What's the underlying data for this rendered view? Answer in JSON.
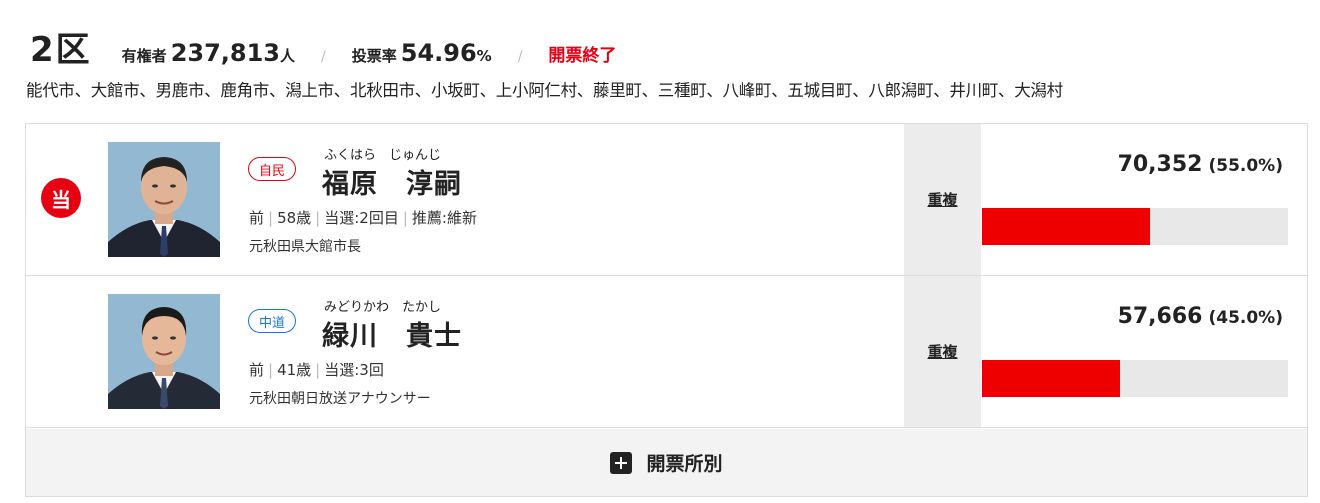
{
  "district": {
    "name": "2区",
    "electorate_label": "有権者",
    "electorate_value": "237,813",
    "electorate_unit": "人",
    "turnout_label": "投票率",
    "turnout_value": "54.96",
    "turnout_unit": "%",
    "status": "開票終了",
    "areas": "能代市、大館市、男鹿市、鹿角市、潟上市、北秋田市、小坂町、上小阿仁村、藤里町、三種町、八峰町、五城目町、八郎潟町、井川町、大潟村"
  },
  "candidates": [
    {
      "elected_badge": "当",
      "party": "自民",
      "party_color": "#e60012",
      "kana": "ふくはら　じゅんじ",
      "name": "福原　淳嗣",
      "status": "前",
      "age": "58歳",
      "terms": "当選:2回目",
      "endorsement": "推薦:維新",
      "career": "元秋田県大館市長",
      "duplicate": "重複",
      "votes": "70,352",
      "percent": "(55.0%)",
      "share": 0.55
    },
    {
      "elected_badge": "",
      "party": "中道",
      "party_color": "#1a73e8",
      "kana": "みどりかわ　たかし",
      "name": "緑川　貴士",
      "status": "前",
      "age": "41歳",
      "terms": "当選:3回",
      "career": "元秋田朝日放送アナウンサー",
      "duplicate": "重複",
      "votes": "57,666",
      "percent": "(45.0%)",
      "share": 0.45
    }
  ],
  "polling_button": {
    "label": "開票所別",
    "icon": "plus-square-icon"
  },
  "colors": {
    "accent_red": "#e60012",
    "bar_fill": "#ee0000",
    "bar_bg": "#e8e8e8"
  }
}
